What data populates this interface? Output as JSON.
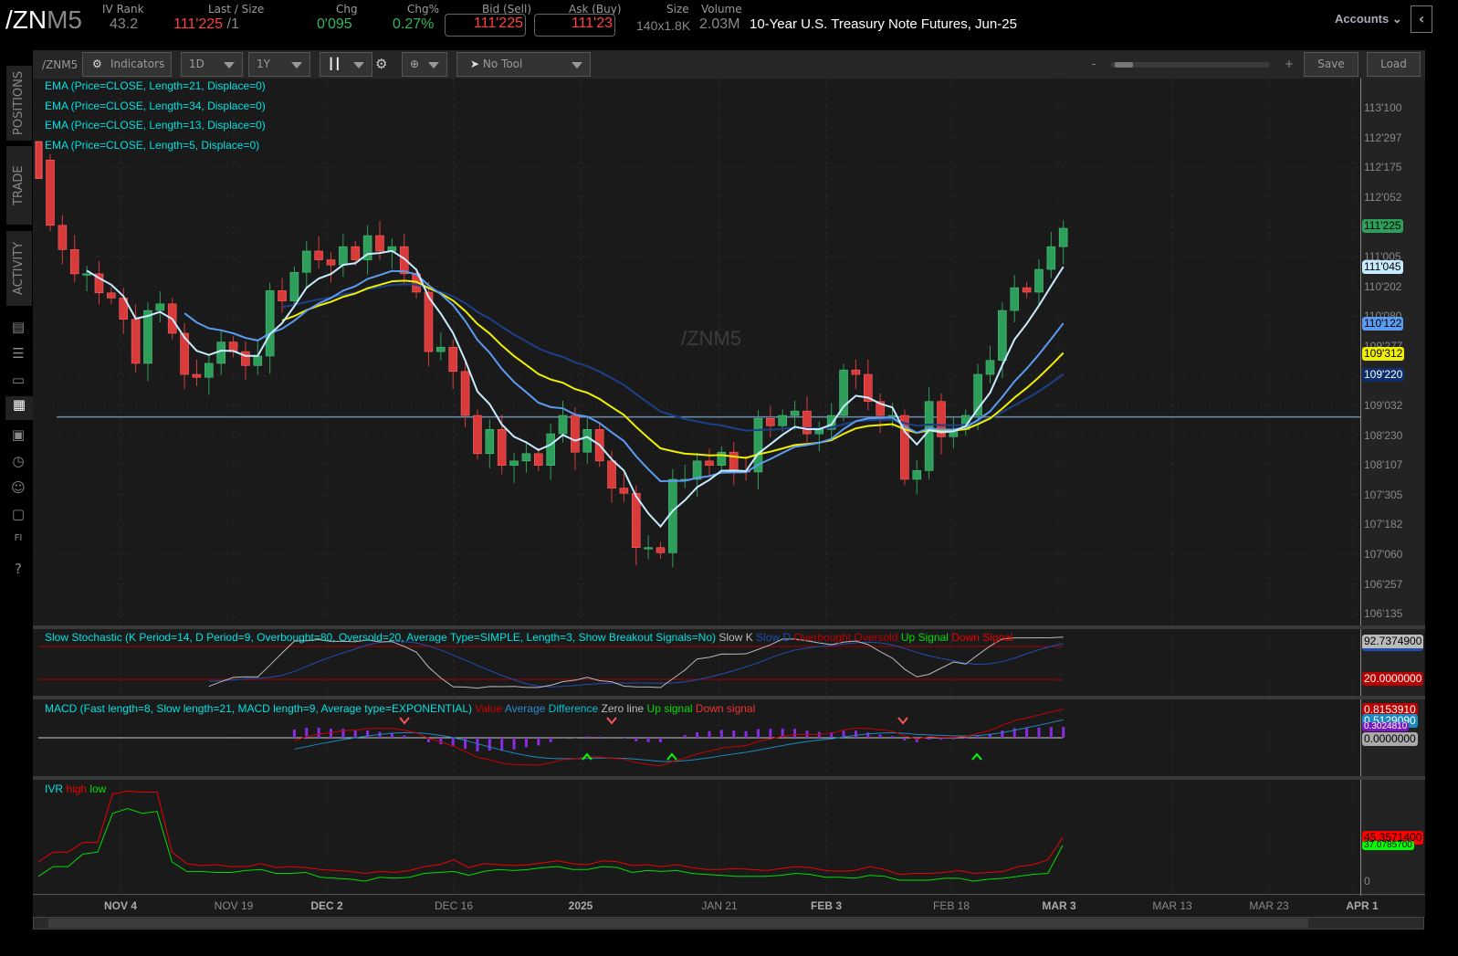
{
  "header": {
    "symbol_a": "/ZN",
    "symbol_b": "M5",
    "iv_rank_label": "IV Rank",
    "iv_rank": "43.2",
    "last_label": "Last / Size",
    "last": "111'225",
    "last_size": "/1",
    "chg_label": "Chg",
    "chg": "0'095",
    "chgp_label": "Chg%",
    "chgp": "0.27%",
    "bid_label": "Bid (Sell)",
    "bid": "111'225",
    "ask_label": "Ask (Buy)",
    "ask": "111'23",
    "size_label": "Size",
    "size": "140x1.8K",
    "volume_label": "Volume",
    "volume": "2.03M",
    "description": "10-Year U.S. Treasury Note Futures, Jun-25",
    "accounts": "Accounts"
  },
  "sidebar": {
    "tabs": [
      "POSITIONS",
      "TRADE",
      "ACTIVITY"
    ]
  },
  "toolbar": {
    "symbol": "/ZNM5",
    "indicators": "Indicators",
    "aggregation": "1D",
    "timeframe": "1Y",
    "tool": "No Tool",
    "zoom_minus": "-",
    "zoom_plus": "+",
    "save": "Save",
    "load": "Load"
  },
  "studies": {
    "ema": [
      "EMA (Price=CLOSE, Length=21, Displace=0)",
      "EMA (Price=CLOSE, Length=34, Displace=0)",
      "EMA (Price=CLOSE, Length=13, Displace=0)",
      "EMA (Price=CLOSE, Length=5, Displace=0)"
    ],
    "stoch": {
      "title": "Slow Stochastic (K Period=14, D Period=9, Overbought=80, Oversold=20, Average Type=SIMPLE, Length=3, Show Breakout Signals=No)",
      "slowk": "Slow K",
      "slowd": "Slow D",
      "ob": "Overbought",
      "os": "Oversold",
      "up": "Up Signal",
      "down": "Down Signal"
    },
    "macd": {
      "title": "MACD (Fast length=8, Slow length=21, MACD length=9, Average type=EXPONENTIAL)",
      "value": "Value",
      "avg": "Average",
      "diff": "Difference",
      "zero": "Zero line",
      "up": "Up signal",
      "down": "Down signal"
    },
    "ivr": {
      "title": "IVR",
      "high": "high",
      "low": "low"
    }
  },
  "watermark": "/ZNM5",
  "price_axis": [
    "113'100",
    "112'297",
    "112'175",
    "112'052",
    "111'127",
    "111'005",
    "110'202",
    "110'080",
    "109'277",
    "109'155",
    "109'032",
    "108'230",
    "108'107",
    "107'305",
    "107'182",
    "107'060",
    "106'257",
    "106'135"
  ],
  "price_tags": {
    "last": "111'225",
    "ema5": "111'045",
    "ema13": "110'122",
    "ema21": "109'312",
    "ema34": "109'220"
  },
  "lower_tags": {
    "stoch_k": "92.7374900",
    "stoch_os": "20.0000000",
    "macd_value": "0.8153910",
    "macd_avg": "0.5129090",
    "macd_diff": "0.3024810",
    "macd_zero": "0.0000000",
    "ivr_high": "45.3571400",
    "ivr_low": "37.0785700",
    "ivr_axis_0": "0"
  },
  "date_axis": [
    "NOV 4",
    "NOV 19",
    "DEC 2",
    "DEC 16",
    "2025",
    "JAN 21",
    "FEB 3",
    "FEB 18",
    "MAR 3",
    "MAR 13",
    "MAR 23",
    "APR 1"
  ],
  "colors": {
    "up": "#2e9e5b",
    "down": "#d93b3b",
    "ema5": "#c8ecff",
    "ema13": "#5b9bf0",
    "ema21": "#f0f000",
    "ema34": "#1c3f8a",
    "study_text": "#00e0e0"
  },
  "chart_data": {
    "type": "candlestick",
    "first_open": 112.6,
    "support_line": 109.1,
    "price_range": [
      106.42,
      113.31
    ],
    "closes": [
      111.71,
      111.38,
      111.05,
      111.05,
      110.79,
      110.72,
      110.43,
      109.83,
      110.55,
      110.64,
      110.24,
      109.68,
      109.64,
      109.83,
      110.12,
      109.99,
      109.8,
      109.93,
      110.82,
      110.68,
      111.07,
      111.36,
      111.24,
      111.17,
      111.42,
      111.24,
      111.57,
      111.36,
      111.42,
      111.05,
      110.8,
      109.99,
      110.05,
      109.72,
      109.12,
      108.6,
      108.93,
      108.44,
      108.5,
      108.6,
      108.44,
      108.87,
      109.12,
      108.62,
      108.93,
      108.5,
      108.13,
      108.06,
      107.32,
      107.32,
      107.25,
      108.25,
      108.25,
      108.5,
      108.44,
      108.62,
      108.37,
      108.35,
      109.08,
      108.98,
      109.12,
      109.18,
      108.87,
      108.93,
      109.12,
      109.74,
      109.68,
      109.31,
      109.12,
      109.12,
      108.25,
      108.37,
      109.31,
      108.83,
      108.93,
      109.12,
      109.68,
      109.87,
      110.55,
      110.86,
      110.8,
      111.11,
      111.42,
      111.67
    ],
    "ivr_high": [
      20,
      30,
      30,
      40,
      40,
      90,
      93,
      92,
      92,
      30,
      18,
      16,
      17,
      15,
      15,
      18,
      14,
      15,
      14,
      12,
      11,
      10,
      8,
      10,
      9,
      11,
      15,
      17,
      22,
      14,
      18,
      17,
      16,
      17,
      19,
      21,
      18,
      17,
      21,
      20,
      16,
      17,
      15,
      17,
      14,
      12,
      12,
      13,
      12,
      11,
      13,
      15,
      14,
      11,
      10,
      11,
      15,
      12,
      7,
      8,
      8,
      9,
      11,
      8,
      9,
      10,
      15,
      17,
      22,
      45
    ],
    "ivr_low": [
      5,
      15,
      15,
      28,
      30,
      70,
      75,
      70,
      72,
      20,
      10,
      10,
      9,
      9,
      11,
      12,
      8,
      8,
      9,
      4,
      3,
      2,
      0,
      4,
      3,
      4,
      8,
      9,
      10,
      6,
      10,
      12,
      11,
      12,
      14,
      15,
      12,
      12,
      15,
      14,
      9,
      11,
      10,
      11,
      8,
      7,
      6,
      5,
      5,
      5,
      6,
      8,
      7,
      4,
      4,
      3,
      6,
      5,
      1,
      1,
      1,
      3,
      3,
      0,
      2,
      3,
      5,
      7,
      8,
      37
    ]
  }
}
